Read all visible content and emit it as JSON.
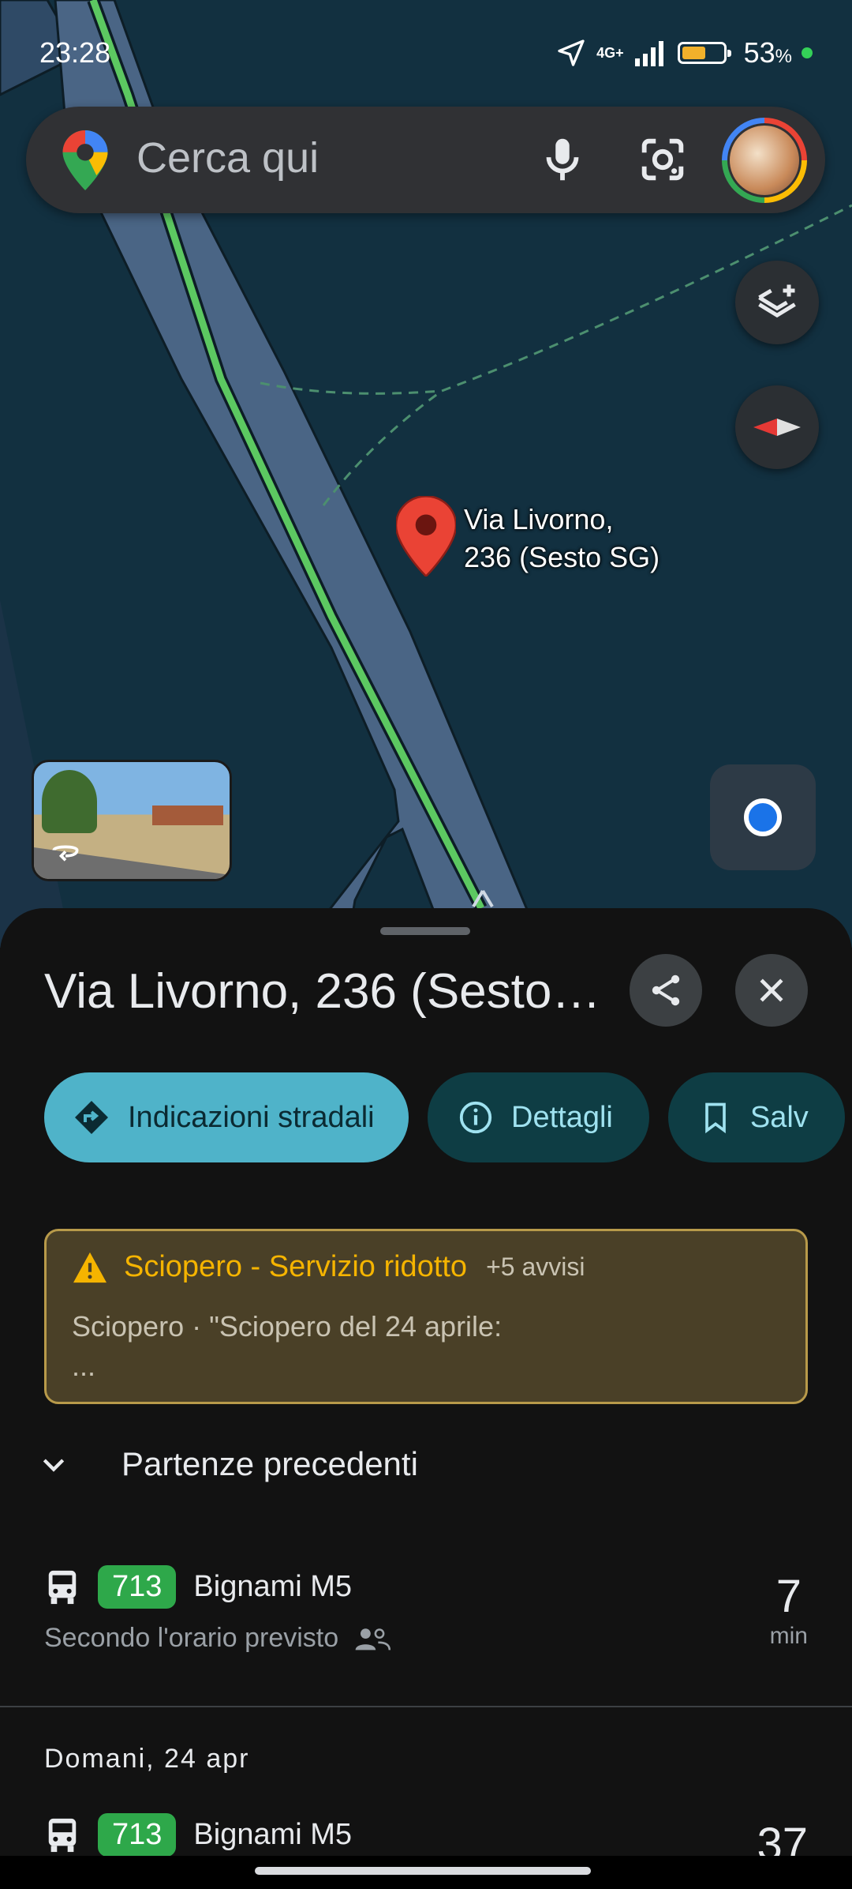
{
  "status_bar": {
    "time": "23:28",
    "network": "4G+",
    "battery": "53",
    "battery_unit": "%",
    "battery_level": 0.53
  },
  "search": {
    "placeholder": "Cerca qui"
  },
  "map": {
    "pin_label_line1": "Via Livorno,",
    "pin_label_line2": "236 (Sesto SG)"
  },
  "place": {
    "title": "Via Livorno, 236 (Sesto…",
    "actions": {
      "directions": "Indicazioni stradali",
      "details": "Dettagli",
      "save": "Salv"
    }
  },
  "alert": {
    "title": "Sciopero - Servizio ridotto",
    "more": "+5 avvisi",
    "body_line1": "Sciopero · \"Sciopero del 24 aprile:",
    "body_line2": "..."
  },
  "previous_departures": {
    "label": "Partenze precedenti"
  },
  "departures": [
    {
      "line": "713",
      "destination": "Bignami M5",
      "status": "Secondo l'orario previsto",
      "minutes": "7",
      "unit": "min"
    }
  ],
  "tomorrow": {
    "label": "Domani, 24 apr",
    "departures": [
      {
        "line": "713",
        "destination": "Bignami M5",
        "minutes": "37"
      }
    ]
  },
  "colors": {
    "accent": "#4fb3c9",
    "alert": "#f5b400",
    "badge": "#2ea84a",
    "route": "#5cc861"
  }
}
